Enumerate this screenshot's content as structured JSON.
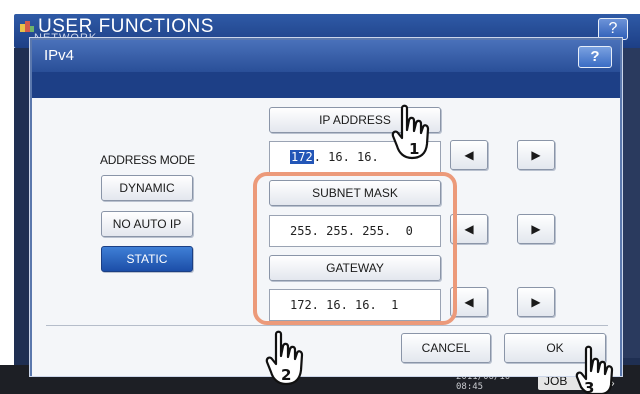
{
  "background_window": {
    "title": "USER FUNCTIONS",
    "subtitle": "NETWORK",
    "help_label": "?",
    "clock_date": "2011/06/10",
    "clock_time": "08:45",
    "job_label": "JOB STATUS",
    "dots": "»"
  },
  "dialog": {
    "title": "IPv4",
    "help_label": "?",
    "address_mode_label": "ADDRESS MODE",
    "mode_buttons": {
      "dynamic": "DYNAMIC",
      "no_auto_ip": "NO AUTO IP",
      "static": "STATIC",
      "selected": "STATIC"
    },
    "ip_address": {
      "label": "IP ADDRESS",
      "octet1": "172",
      "rest": ". 16. 16."
    },
    "subnet_mask": {
      "label": "SUBNET MASK",
      "value": "255. 255. 255.  0"
    },
    "gateway": {
      "label": "GATEWAY",
      "value": "172. 16. 16.  1"
    },
    "arrows": {
      "left": "◀",
      "right": "▶"
    },
    "cancel_label": "CANCEL",
    "ok_label": "OK"
  },
  "callouts": {
    "step1": "1",
    "step2": "2",
    "step3": "3"
  },
  "colors": {
    "title_bar": "#2a4f98",
    "selected_button": "#1c4ea8",
    "callout_orange": "#ec9a7a",
    "background_dark": "#1f2f52"
  }
}
